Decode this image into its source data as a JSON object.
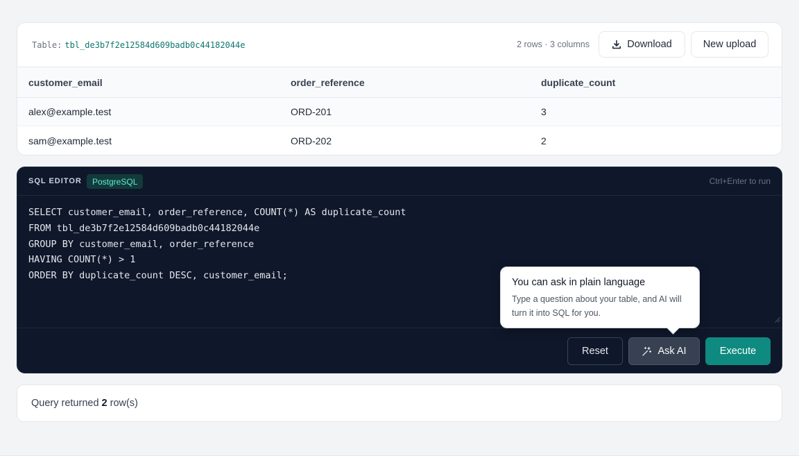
{
  "table_card": {
    "table_label": "Table:",
    "table_name": "tbl_de3b7f2e12584d609badb0c44182044e",
    "stats": "2 rows · 3 columns",
    "download_label": "Download",
    "upload_label": "New upload",
    "columns": [
      "customer_email",
      "order_reference",
      "duplicate_count"
    ],
    "rows": [
      [
        "alex@example.test",
        "ORD-201",
        "3"
      ],
      [
        "sam@example.test",
        "ORD-202",
        "2"
      ]
    ]
  },
  "editor": {
    "title": "SQL EDITOR",
    "dialect": "PostgreSQL",
    "hint": "Ctrl+Enter to run",
    "code": "SELECT customer_email, order_reference, COUNT(*) AS duplicate_count\nFROM tbl_de3b7f2e12584d609badb0c44182044e\nGROUP BY customer_email, order_reference\nHAVING COUNT(*) > 1\nORDER BY duplicate_count DESC, customer_email;",
    "reset_label": "Reset",
    "ask_ai_label": "Ask AI",
    "execute_label": "Execute"
  },
  "tooltip": {
    "title": "You can ask in plain language",
    "body": "Type a question about your table, and AI will turn it into SQL for you."
  },
  "result": {
    "prefix": "Query returned",
    "count": "2",
    "suffix": "row(s)"
  },
  "colors": {
    "accent": "#0f8a80",
    "editor_bg": "#0f172a",
    "table_name": "#0f766e",
    "page_bg": "#f3f4f6"
  },
  "icons": {
    "download": "download-icon",
    "ask_ai": "sparkle-icon"
  }
}
